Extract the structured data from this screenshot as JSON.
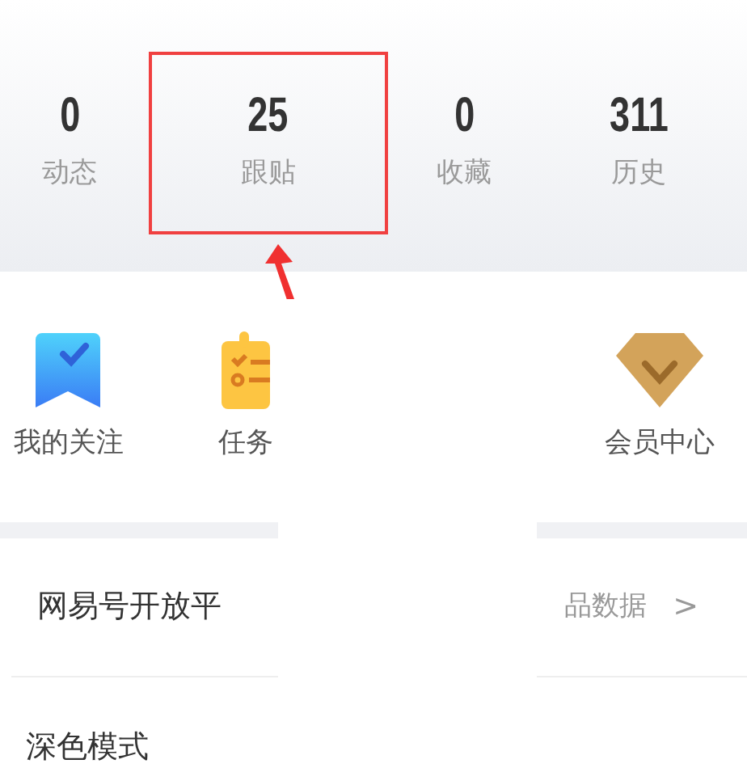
{
  "stats": [
    {
      "value": "0",
      "label": "动态",
      "highlighted": false
    },
    {
      "value": "25",
      "label": "跟贴",
      "highlighted": true
    },
    {
      "value": "0",
      "label": "收藏",
      "highlighted": false
    },
    {
      "value": "311",
      "label": "历史",
      "highlighted": false
    }
  ],
  "shortcuts": [
    {
      "kind": "bookmark",
      "label": "我的关注"
    },
    {
      "kind": "tasks",
      "label": "任务"
    },
    {
      "kind": "member",
      "label": "会员中心"
    }
  ],
  "settings": [
    {
      "label": "网易号开放平",
      "detail": "品数据",
      "chevron": ">"
    },
    {
      "label": "深色模式"
    }
  ]
}
